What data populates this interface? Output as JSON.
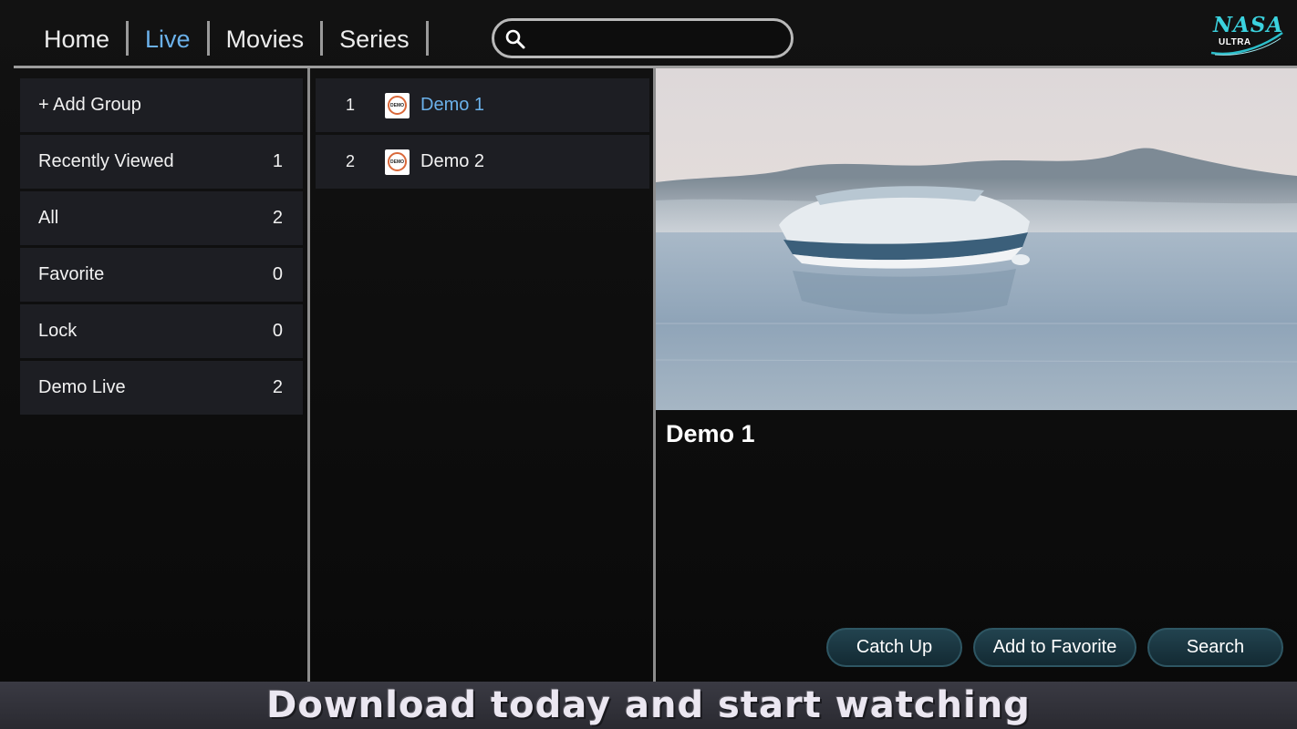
{
  "nav": {
    "items": [
      {
        "label": "Home",
        "active": false
      },
      {
        "label": "Live",
        "active": true
      },
      {
        "label": "Movies",
        "active": false
      },
      {
        "label": "Series",
        "active": false
      }
    ],
    "search_value": ""
  },
  "logo": {
    "text": "NASA",
    "sub": "ULTRA"
  },
  "groups": [
    {
      "label": "+ Add Group",
      "count": ""
    },
    {
      "label": "Recently Viewed",
      "count": "1"
    },
    {
      "label": "All",
      "count": "2"
    },
    {
      "label": "Favorite",
      "count": "0"
    },
    {
      "label": "Lock",
      "count": "0"
    },
    {
      "label": "Demo Live",
      "count": "2"
    }
  ],
  "channels": [
    {
      "num": "1",
      "name": "Demo 1",
      "logo": "DEMO",
      "active": true
    },
    {
      "num": "2",
      "name": "Demo 2",
      "logo": "DEMO",
      "active": false
    }
  ],
  "now_playing": {
    "title": "Demo 1"
  },
  "actions": {
    "catch_up": "Catch Up",
    "add_favorite": "Add to Favorite",
    "search": "Search"
  },
  "banner": {
    "text": "Download today and start watching"
  },
  "colors": {
    "accent": "#6bb1ea",
    "panel": "#1d1e23",
    "button": "#1b3944"
  }
}
